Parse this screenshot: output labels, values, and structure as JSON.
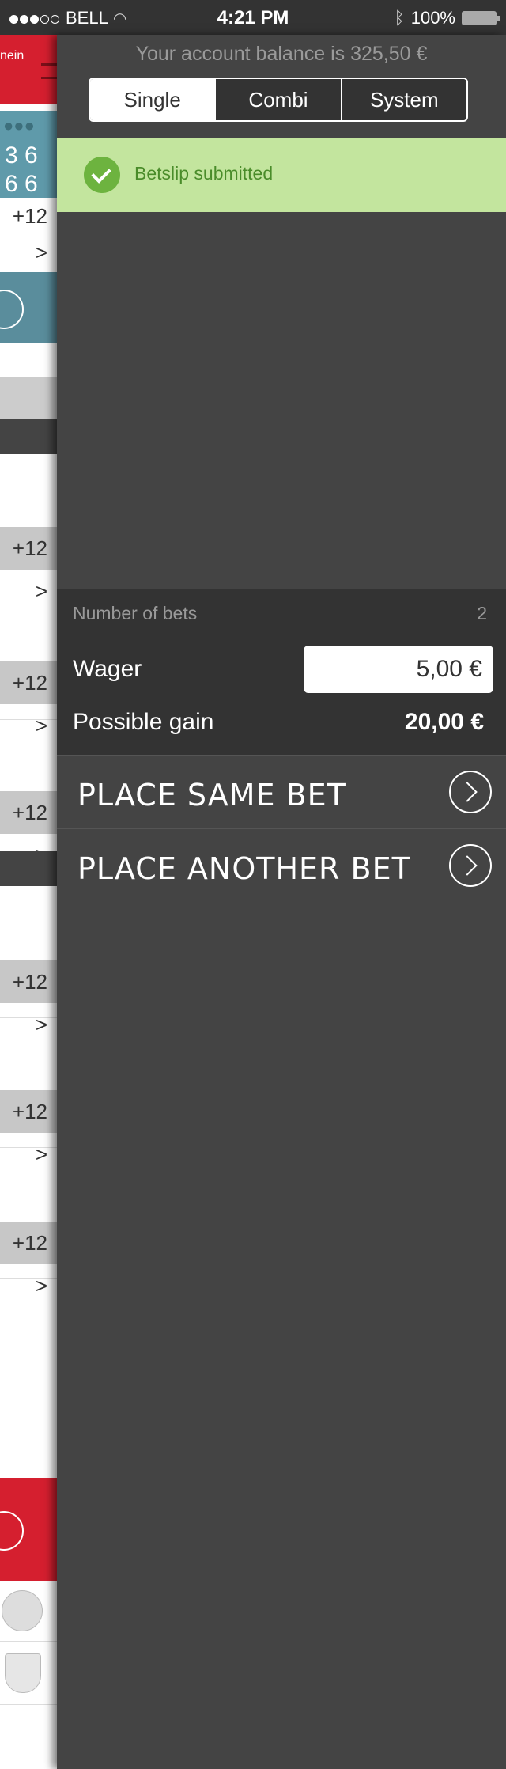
{
  "status_bar": {
    "carrier": "BELL",
    "time": "4:21 PM",
    "battery": "100%"
  },
  "background_app": {
    "header_text": "nein",
    "score_row_1": "3 6",
    "score_row_2": "6 6",
    "more_label": "+12 >"
  },
  "panel": {
    "balance": "Your account balance is 325,50 €",
    "tabs": [
      {
        "label": "Single"
      },
      {
        "label": "Combi"
      },
      {
        "label": "System"
      }
    ],
    "notification": "Betslip submitted",
    "summary": {
      "bets_label": "Number of bets",
      "bets_value": "2",
      "wager_label": "Wager",
      "wager_value": "5,00 €",
      "gain_label": "Possible gain",
      "gain_value": "20,00 €"
    },
    "actions": {
      "same_bet": "PLACE SAME BET",
      "another_bet": "PLACE ANOTHER BET"
    }
  }
}
